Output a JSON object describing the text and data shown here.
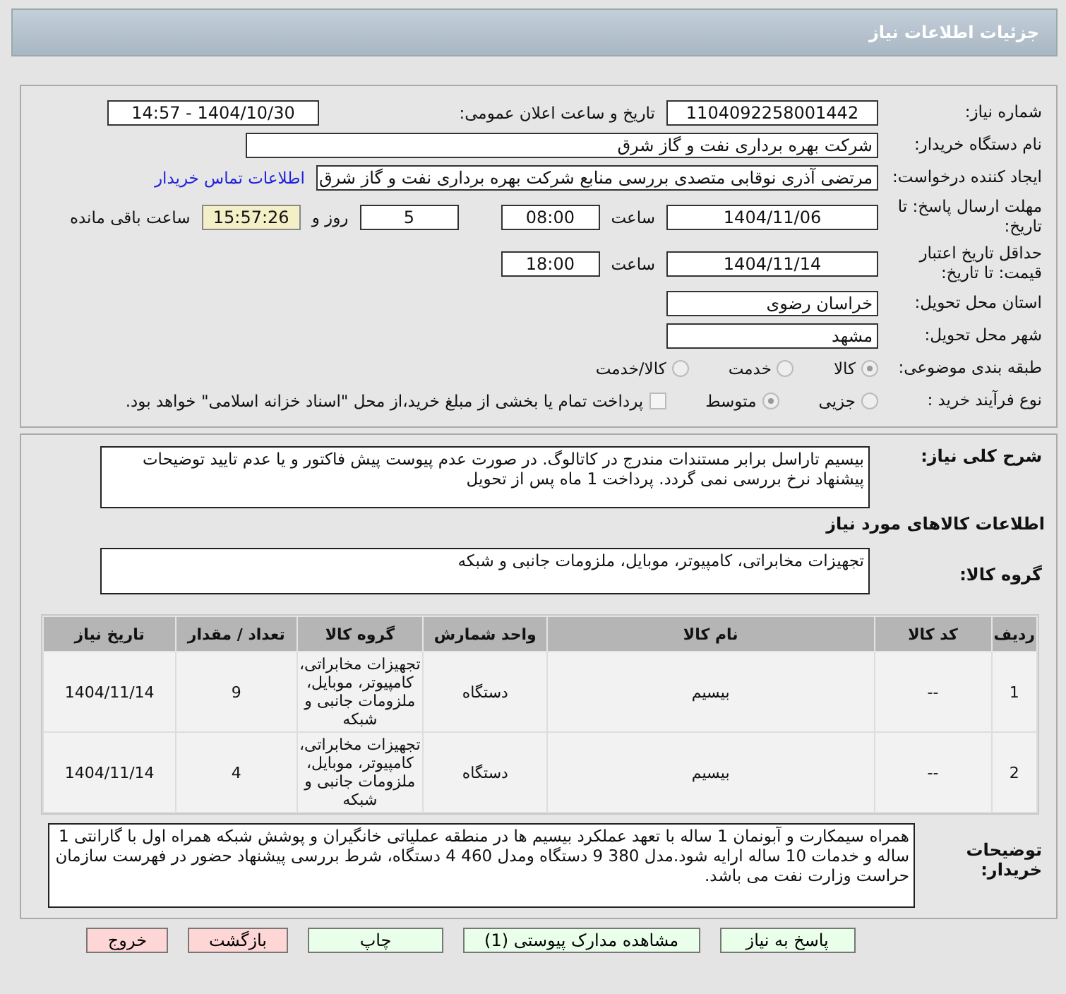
{
  "header": {
    "title": "جزئیات اطلاعات نیاز"
  },
  "details": {
    "need_number": {
      "label": "شماره نیاز:",
      "value": "1104092258001442"
    },
    "announce": {
      "label": "تاریخ و ساعت اعلان عمومی:",
      "value": "1404/10/30 - 14:57"
    },
    "buyer_org": {
      "label": "نام دستگاه خریدار:",
      "value": "شرکت بهره برداری نفت و گاز شرق"
    },
    "creator": {
      "label": "ایجاد کننده درخواست:",
      "value": "مرتضی آذری نوقابی متصدی بررسی منابع شرکت بهره برداری نفت و گاز شرق",
      "link": "اطلاعات تماس خریدار"
    },
    "deadline": {
      "label": "مهلت ارسال پاسخ: تا تاریخ:",
      "date": "1404/11/06",
      "time_label": "ساعت",
      "time": "08:00",
      "days": "5",
      "days_label": "روز و",
      "remaining": "15:57:26",
      "remaining_label": "ساعت باقی مانده"
    },
    "validity": {
      "label": "حداقل تاریخ اعتبار قیمت: تا تاریخ:",
      "date": "1404/11/14",
      "time_label": "ساعت",
      "time": "18:00"
    },
    "province": {
      "label": "استان محل تحویل:",
      "value": "خراسان رضوی"
    },
    "city": {
      "label": "شهر محل تحویل:",
      "value": "مشهد"
    },
    "category": {
      "label": "طبقه بندی موضوعی:",
      "options": [
        {
          "label": "کالا",
          "selected": true
        },
        {
          "label": "خدمت",
          "selected": false
        },
        {
          "label": "کالا/خدمت",
          "selected": false
        }
      ]
    },
    "process": {
      "label": "نوع فرآیند خرید :",
      "options": [
        {
          "label": "جزیی",
          "selected": false
        },
        {
          "label": "متوسط",
          "selected": true
        }
      ],
      "treasury": {
        "label": "پرداخت تمام یا بخشی از مبلغ خرید،از محل \"اسناد خزانه اسلامی\" خواهد بود.",
        "checked": false
      }
    }
  },
  "summary": {
    "label": "شرح کلی نیاز:",
    "value": "بیسیم تاراسل برابر مستندات مندرج در کاتالوگ. در صورت عدم پیوست پیش فاکتور و یا عدم تایید توضیحات پیشنهاد نرخ بررسی نمی گردد. پرداخت 1 ماه پس از تحویل"
  },
  "goods_title": "اطلاعات کالاهای مورد نیاز",
  "goods_group": {
    "label": "گروه کالا:",
    "value": "تجهیزات مخابراتی، کامپیوتر، موبایل، ملزومات جانبی و شبکه"
  },
  "table": {
    "columns": [
      "ردیف",
      "کد کالا",
      "نام کالا",
      "واحد شمارش",
      "گروه کالا",
      "تعداد / مقدار",
      "تاریخ نیاز"
    ],
    "rows": [
      [
        "1",
        "--",
        "بیسیم",
        "دستگاه",
        "تجهیزات مخابراتی، کامپیوتر، موبایل، ملزومات جانبی و شبکه",
        "9",
        "1404/11/14"
      ],
      [
        "2",
        "--",
        "بیسیم",
        "دستگاه",
        "تجهیزات مخابراتی، کامپیوتر، موبایل، ملزومات جانبی و شبکه",
        "4",
        "1404/11/14"
      ]
    ]
  },
  "buyer_notes": {
    "label": "توضیحات خریدار:",
    "value": "همراه سیمکارت و آبونمان 1 ساله با تعهد عملکرد بیسیم ها در منطقه عملیاتی خانگیران و پوشش شبکه همراه اول با گارانتی 1 ساله و خدمات 10 ساله  ارایه شود.مدل 380 9 دستگاه ومدل 460 4 دستگاه، شرط بررسی پیشنهاد حضور در فهرست سازمان حراست وزارت نفت می باشد."
  },
  "buttons": [
    {
      "label": "پاسخ به نیاز",
      "kind": "action"
    },
    {
      "label": "مشاهده مدارک پیوستی (1)",
      "kind": "action"
    },
    {
      "label": "چاپ",
      "kind": "action"
    },
    {
      "label": "بازگشت",
      "kind": "exit"
    },
    {
      "label": "خروج",
      "kind": "exit"
    }
  ]
}
